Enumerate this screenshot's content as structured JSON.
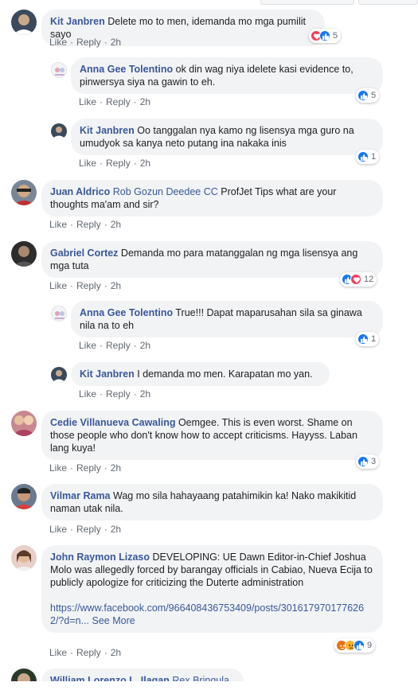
{
  "actions": {
    "like": "Like",
    "reply": "Reply",
    "sep": "·"
  },
  "comments": [
    {
      "author": "Kit Janbren",
      "tag": "",
      "text": "Delete mo to men, idemanda mo mga pumilit sayo",
      "time": "2h",
      "reactions": [
        "love",
        "like"
      ],
      "count": "5"
    },
    {
      "author": "Anna Gee Tolentino",
      "tag": "",
      "text": "ok din wag niya idelete kasi evidence to, pinwersya siya na gawin to eh.",
      "time": "2h",
      "reactions": [
        "like"
      ],
      "count": "5"
    },
    {
      "author": "Kit Janbren",
      "tag": "",
      "text": "Oo tanggalan nya kamo ng lisensya mga guro na umudyok sa kanya neto putang ina nakaka inis",
      "time": "2h",
      "reactions": [
        "like"
      ],
      "count": "1"
    },
    {
      "author": "Juan Aldrico",
      "tag": "Rob Gozun Deedee CC",
      "text": "ProfJet Tips what are your thoughts ma'am and sir?",
      "time": "2h",
      "reactions": [],
      "count": ""
    },
    {
      "author": "Gabriel Cortez",
      "tag": "",
      "text": "Demanda mo para matanggalan ng mga lisensya ang mga tuta",
      "time": "2h",
      "reactions": [
        "like",
        "love"
      ],
      "count": "12"
    },
    {
      "author": "Anna Gee Tolentino",
      "tag": "",
      "text": "True!!! Dapat maparusahan sila sa ginawa nila na to eh",
      "time": "2h",
      "reactions": [
        "like"
      ],
      "count": "1"
    },
    {
      "author": "Kit Janbren",
      "tag": "",
      "text": "I demanda mo men. Karapatan mo yan.",
      "time": "2h",
      "reactions": [],
      "count": ""
    },
    {
      "author": "Cedie Villanueva Cawaling",
      "tag": "",
      "text": "Oemgee. This is even worst. Shame on those people who don't know how to accept criticisms. Hayyss. Laban lang kuya!",
      "time": "2h",
      "reactions": [
        "like"
      ],
      "count": "3"
    },
    {
      "author": "Vilmar Rama",
      "tag": "",
      "text": "Wag mo sila hahayaang patahimikin ka! Nako makikitid naman utak nila.",
      "time": "2h",
      "reactions": [],
      "count": ""
    },
    {
      "author": "John Raymon Lizaso",
      "tag": "",
      "text": "DEVELOPING: UE Dawn Editor-in-Chief Joshua Molo was allegedly forced by barangay officials in Cabiao, Nueva Ecija to publicly apologize for criticizing the Duterte administration",
      "link": "https://www.facebook.com/966408436753409/posts/3016179701776262/?d=n...",
      "see_more": "See More",
      "time": "2h",
      "reactions": [
        "angry",
        "sad",
        "like"
      ],
      "count": "9"
    },
    {
      "author": "William Lorenzo L. Ilagan",
      "tag": "Rex Bringula",
      "text": "",
      "time": "",
      "reactions": [],
      "count": ""
    }
  ],
  "colors": {
    "name": "#385898",
    "bubble": "#f2f3f5",
    "meta": "#606770",
    "like": "#1877f2",
    "love": "#f33e58"
  }
}
